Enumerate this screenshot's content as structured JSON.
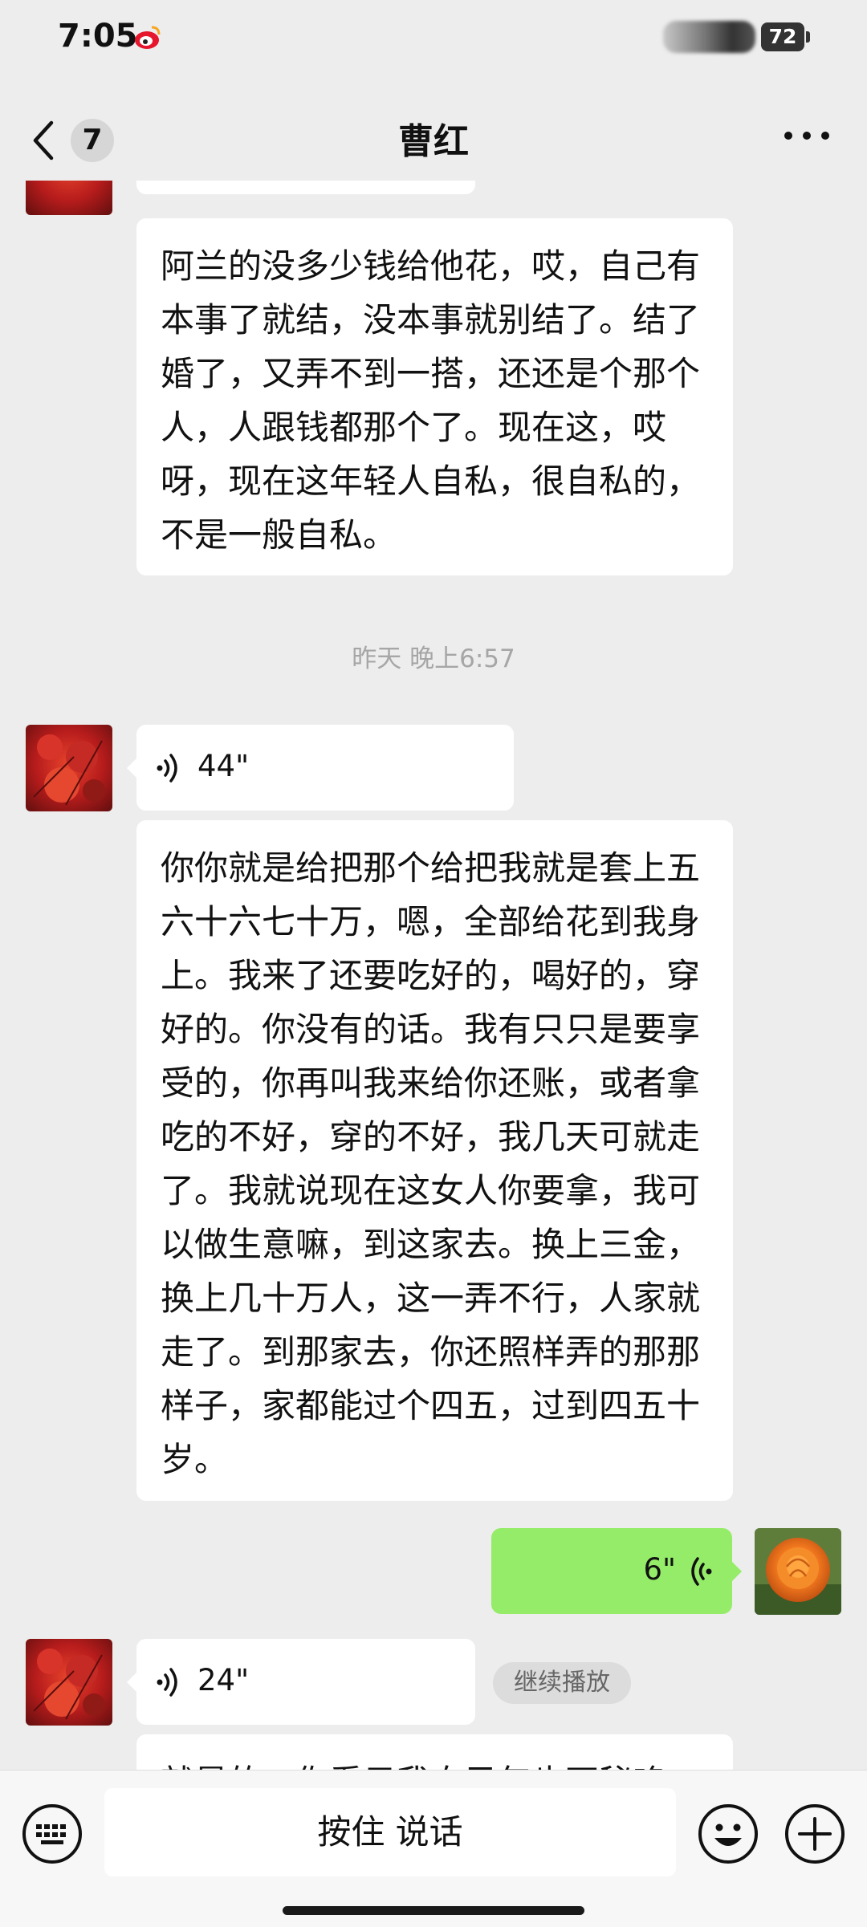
{
  "status": {
    "time": "7:05",
    "battery": "72"
  },
  "header": {
    "unread_count": "7",
    "title": "曹红"
  },
  "messages": {
    "m1_text": "阿兰的没多少钱给他花，哎，自己有本事了就结，没本事就别结了。结了婚了，又弄不到一搭，还还是个那个人，人跟钱都那个了。现在这，哎呀，现在这年轻人自私，很自私的，不是一般自私。",
    "timestamp": "昨天 晚上6:57",
    "voice1": "44\"",
    "m2_text": "你你就是给把那个给把我就是套上五六十六七十万，嗯，全部给花到我身上。我来了还要吃好的，喝好的，穿好的。你没有的话。我有只只是要享受的，你再叫我来给你还账，或者拿吃的不好，穿的不好，我几天可就走了。我就说现在这女人你要拿，我可以做生意嘛，到这家去。换上三金，换上几十万人，这一弄不行，人家就走了。到那家去，你还照样弄的那那样子，家都能过个四五，过到四五十岁。",
    "my_voice": "6\"",
    "voice2": "24\"",
    "continue_label": "继续播放",
    "m3_partial": "就是的，你看只我自己年也不秘咯，"
  },
  "composer": {
    "hold_to_talk": "按住 说话"
  },
  "colors": {
    "background": "#ededed",
    "my_bubble": "#95ec69",
    "their_bubble": "#ffffff"
  },
  "icons": [
    "weibo-icon",
    "back-chevron-icon",
    "more-dots-icon",
    "voice-wave-icon",
    "keyboard-icon",
    "emoji-icon",
    "plus-icon"
  ]
}
